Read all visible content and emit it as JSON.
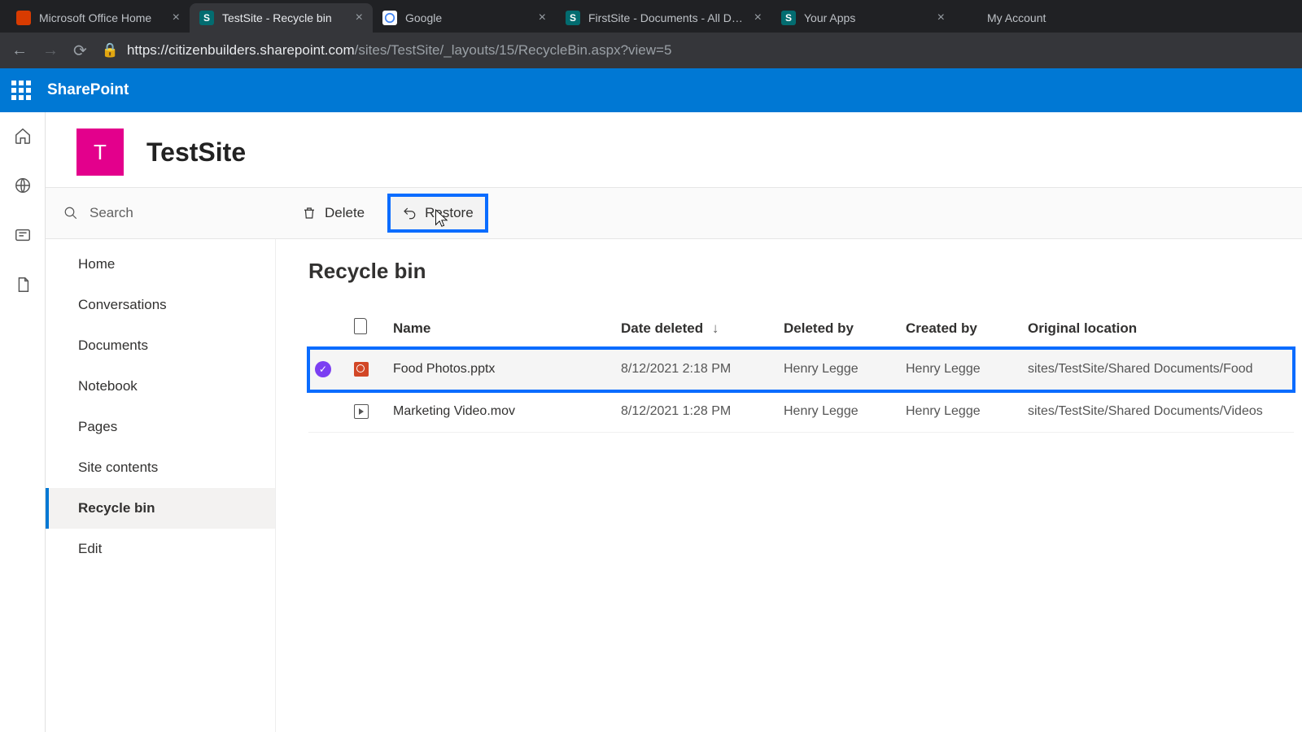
{
  "browser": {
    "tabs": [
      {
        "title": "Microsoft Office Home"
      },
      {
        "title": "TestSite - Recycle bin"
      },
      {
        "title": "Google"
      },
      {
        "title": "FirstSite - Documents - All Docu"
      },
      {
        "title": "Your Apps"
      },
      {
        "title": "My Account"
      }
    ],
    "url_host": "https://citizenbuilders.sharepoint.com",
    "url_path": "/sites/TestSite/_layouts/15/RecycleBin.aspx?view=5"
  },
  "suite": {
    "name": "SharePoint"
  },
  "site": {
    "logo_letter": "T",
    "title": "TestSite"
  },
  "search": {
    "placeholder": "Search"
  },
  "commands": {
    "delete": "Delete",
    "restore": "Restore"
  },
  "nav": {
    "items": [
      "Home",
      "Conversations",
      "Documents",
      "Notebook",
      "Pages",
      "Site contents",
      "Recycle bin",
      "Edit"
    ],
    "active_index": 6
  },
  "page": {
    "title": "Recycle bin"
  },
  "table": {
    "headers": {
      "name": "Name",
      "date_deleted": "Date deleted",
      "deleted_by": "Deleted by",
      "created_by": "Created by",
      "original_location": "Original location"
    },
    "rows": [
      {
        "selected": true,
        "icon": "ppt",
        "name": "Food Photos.pptx",
        "date_deleted": "8/12/2021 2:18 PM",
        "deleted_by": "Henry Legge",
        "created_by": "Henry Legge",
        "original_location": "sites/TestSite/Shared Documents/Food"
      },
      {
        "selected": false,
        "icon": "video",
        "name": "Marketing Video.mov",
        "date_deleted": "8/12/2021 1:28 PM",
        "deleted_by": "Henry Legge",
        "created_by": "Henry Legge",
        "original_location": "sites/TestSite/Shared Documents/Videos"
      }
    ]
  }
}
